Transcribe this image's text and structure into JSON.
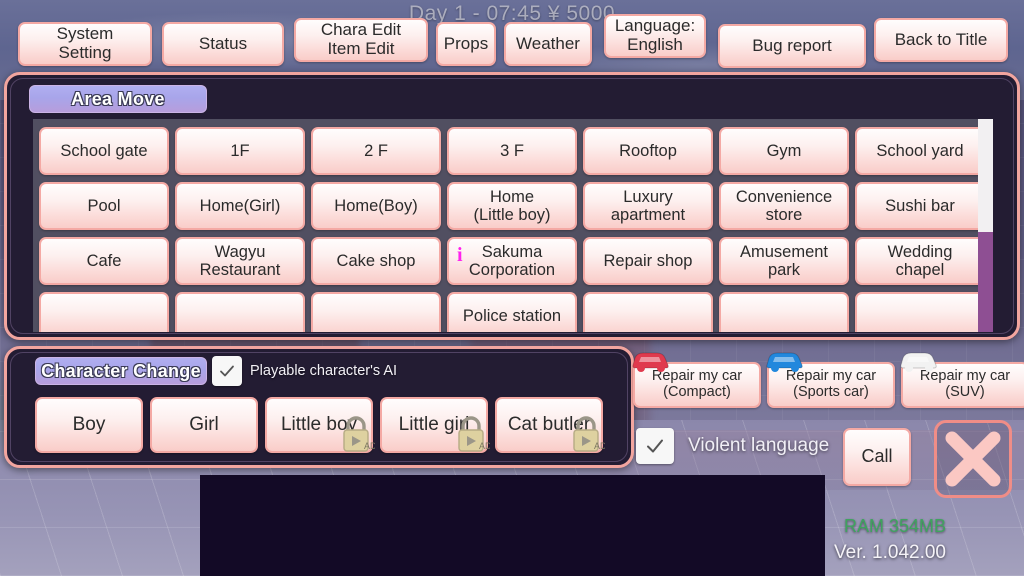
{
  "hud": {
    "status_line": "Day 1 - 07:45  ¥ 5000"
  },
  "toolbar": {
    "system_setting": "System Setting",
    "status": "Status",
    "chara_item_edit": "Chara Edit\nItem Edit",
    "props": "Props",
    "weather": "Weather",
    "language": "Language:\nEnglish",
    "bug_report": "Bug report",
    "back_to_title": "Back to Title"
  },
  "area_move": {
    "header": "Area Move",
    "columns": 7,
    "locations": [
      {
        "label": "School gate"
      },
      {
        "label": "1F"
      },
      {
        "label": "2 F"
      },
      {
        "label": "3 F"
      },
      {
        "label": "Rooftop"
      },
      {
        "label": "Gym"
      },
      {
        "label": "School yard"
      },
      {
        "label": "Pool"
      },
      {
        "label": "Home(Girl)"
      },
      {
        "label": "Home(Boy)"
      },
      {
        "label": "Home\n(Little boy)"
      },
      {
        "label": "Luxury\napartment"
      },
      {
        "label": "Convenience\nstore"
      },
      {
        "label": "Sushi bar"
      },
      {
        "label": "Cafe"
      },
      {
        "label": "Wagyu\nRestaurant"
      },
      {
        "label": "Cake shop"
      },
      {
        "label": "Sakuma\nCorporation",
        "info": true
      },
      {
        "label": "Repair shop"
      },
      {
        "label": "Amusement\npark"
      },
      {
        "label": "Wedding\nchapel"
      },
      {
        "label": ""
      },
      {
        "label": ""
      },
      {
        "label": ""
      },
      {
        "label": "Police station"
      },
      {
        "label": ""
      },
      {
        "label": ""
      },
      {
        "label": ""
      }
    ],
    "scroll_position": "top"
  },
  "character_change": {
    "header": "Character Change",
    "ai_checkbox": {
      "label": "Playable character's AI",
      "checked": true
    },
    "characters": [
      {
        "label": "Boy",
        "locked": false
      },
      {
        "label": "Girl",
        "locked": false
      },
      {
        "label": "Little boy",
        "locked": true,
        "badge": "AD"
      },
      {
        "label": "Little girl",
        "locked": true,
        "badge": "AD"
      },
      {
        "label": "Cat butler",
        "locked": true,
        "badge": "AD"
      }
    ]
  },
  "vehicles": [
    {
      "label": "Repair my car\n(Compact)",
      "color": "#e03a4e"
    },
    {
      "label": "Repair my car\n(Sports car)",
      "color": "#2288dd"
    },
    {
      "label": "Repair my car\n(SUV)",
      "color": "#f2f2f2"
    }
  ],
  "options": {
    "violent_language": {
      "label": "Violent language",
      "checked": true
    }
  },
  "actions": {
    "call": "Call",
    "close": "close-x"
  },
  "footer": {
    "ram": "RAM 354MB",
    "version": "Ver. 1.042.00"
  },
  "colors": {
    "button_border": "#f4a9a4",
    "panel_border": "#f2a59f",
    "panel_bg": "#231c33",
    "header_gradient_start": "#b0aef0",
    "header_gradient_end": "#b79ddc",
    "info_icon": "#ff22ee",
    "ram_text": "#3fa35f",
    "scroll_track": "#8e4f93"
  }
}
